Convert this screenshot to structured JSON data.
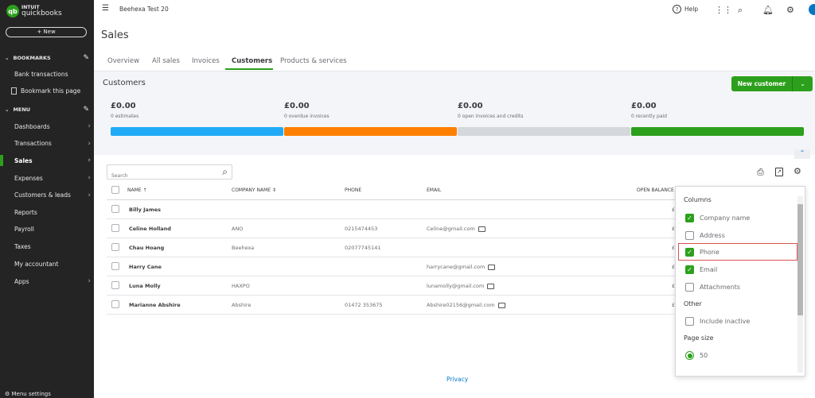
{
  "sidebar": {
    "logo_top": "INTUIT",
    "logo_bottom": "quickbooks",
    "new_label": "+ New",
    "bookmarks_label": "BOOKMARKS",
    "bookmarks": [
      "Bank transactions",
      "Bookmark this page"
    ],
    "menu_label": "MENU",
    "items": [
      {
        "label": "Dashboards",
        "chevron": true
      },
      {
        "label": "Transactions",
        "chevron": true
      },
      {
        "label": "Sales",
        "chevron": true,
        "active": true
      },
      {
        "label": "Expenses",
        "chevron": true
      },
      {
        "label": "Customers & leads",
        "chevron": true
      },
      {
        "label": "Reports",
        "chevron": false
      },
      {
        "label": "Payroll",
        "chevron": false
      },
      {
        "label": "Taxes",
        "chevron": false
      },
      {
        "label": "My accountant",
        "chevron": false
      },
      {
        "label": "Apps",
        "chevron": true
      }
    ],
    "menu_settings": "Menu settings"
  },
  "header": {
    "company": "Beehexa Test 20",
    "help": "Help"
  },
  "page": {
    "title": "Sales",
    "tabs": [
      "Overview",
      "All sales",
      "Invoices",
      "Customers",
      "Products & services"
    ],
    "active_tab": "Customers"
  },
  "summary": {
    "title": "Customers",
    "new_customer": "New customer",
    "stats": [
      {
        "amount": "£0.00",
        "label": "0 estimates",
        "color": "#21abf6"
      },
      {
        "amount": "£0.00",
        "label": "0 overdue invoices",
        "color": "#ff8000"
      },
      {
        "amount": "£0.00",
        "label": "0 open invoices and credits",
        "color": "#d4d7dc"
      },
      {
        "amount": "£0.00",
        "label": "0 recently paid",
        "color": "#2ca01c"
      }
    ]
  },
  "table": {
    "search_placeholder": "Search",
    "headers": {
      "name": "NAME ↑",
      "company": "COMPANY NAME ⇕",
      "phone": "PHONE",
      "email": "EMAIL",
      "balance": "OPEN BALANCE"
    },
    "rows": [
      {
        "name": "Billy James",
        "company": "",
        "phone": "",
        "email": "",
        "balance": "£"
      },
      {
        "name": "Celine Holland",
        "company": "ANO",
        "phone": "0215474453",
        "email": "Celine@gmail.com",
        "balance": "£"
      },
      {
        "name": "Chau Hoang",
        "company": "Beehexa",
        "phone": "02077745141",
        "email": "",
        "balance": "£"
      },
      {
        "name": "Harry Cane",
        "company": "",
        "phone": "",
        "email": "harrycane@gmail.com",
        "balance": "£"
      },
      {
        "name": "Luna Molly",
        "company": "HAXPO",
        "phone": "",
        "email": "lunamolly@gmail.com",
        "balance": "£"
      },
      {
        "name": "Marianne Abshire",
        "company": "Abshire",
        "phone": "01472 353675",
        "email": "Abshire02156@gmail.com",
        "balance": "£"
      }
    ]
  },
  "popup": {
    "columns_title": "Columns",
    "columns": [
      {
        "label": "Company name",
        "checked": true
      },
      {
        "label": "Address",
        "checked": false
      },
      {
        "label": "Phone",
        "checked": true,
        "highlighted": true
      },
      {
        "label": "Email",
        "checked": true
      },
      {
        "label": "Attachments",
        "checked": false
      }
    ],
    "other_title": "Other",
    "other": [
      {
        "label": "Include inactive",
        "checked": false
      }
    ],
    "page_size_title": "Page size",
    "page_size": "50"
  },
  "footer": {
    "privacy": "Privacy"
  }
}
